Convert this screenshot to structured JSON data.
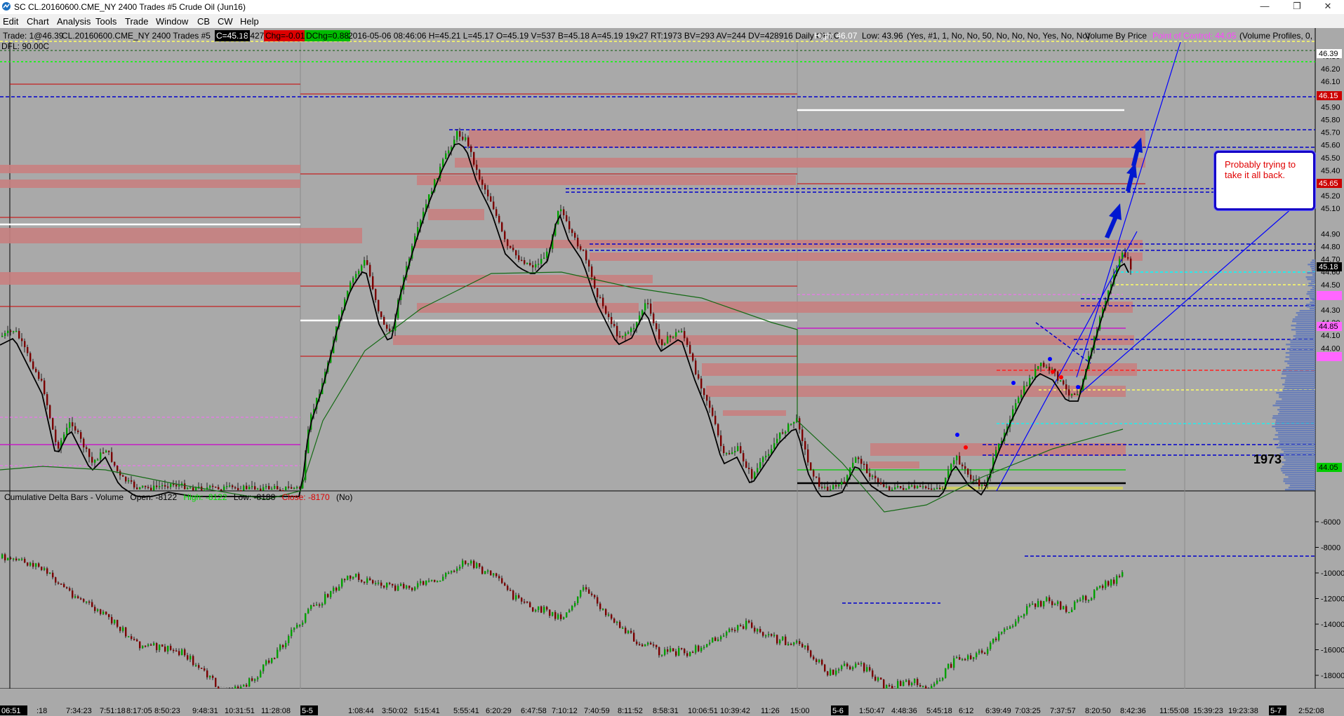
{
  "window": {
    "title": "SC CL.20160600.CME_NY  2400 Trades  #5  Crude Oil (Jun16)",
    "controls": {
      "minimize": "—",
      "restore": "❐",
      "close": "✕"
    }
  },
  "menu": [
    "Edit",
    "Chart",
    "Analysis",
    "Tools",
    "Trade",
    "Window",
    "CB",
    "CW",
    "Help"
  ],
  "header": {
    "trade": "Trade: 1@46.39",
    "symbol": "CL.20160600.CME_NY  2400 Trades  #5",
    "last": "C=45.18",
    "trades": "T=427",
    "chg": "Chg=-0.01",
    "dchg": "DChg=0.88",
    "stats": "2016-05-06 08:46:06 H=45.21 L=45.17 O=45.19 V=537 B=45.18 A=45.19 19x27 RT:1973 BV=293 AV=244 DV=428916 Daily OHLC",
    "high": "High: 46.07",
    "low": "Low: 43.96",
    "params": "(Yes, #1, 1, No, No, 50, No, No, No, Yes, No, No)",
    "study": "Volume By Price",
    "poc": "Point of Control: 44.05",
    "vp": "(Volume Profiles, 0,",
    "dfl": "DFL: 90.00C"
  },
  "annotation": {
    "text": "Probably trying to take it all back."
  },
  "counter": "1973",
  "lower_study": {
    "name": "Cumulative Delta Bars - Volume",
    "open": "Open: -8122",
    "high": "High: -8122",
    "low": "Low: -8188",
    "close": "Close: -8170",
    "flag": "(No)"
  },
  "price_tags": {
    "last_trade": "46.39",
    "upper_blue": "46.15",
    "red": "45.65",
    "current": "45.18",
    "magenta": "44.85",
    "green": "44.05",
    "lower_right": "5"
  },
  "price_axis": [
    "46.30",
    "46.20",
    "46.10",
    "46.00",
    "45.90",
    "45.80",
    "45.70",
    "45.60",
    "45.50",
    "45.40",
    "45.30",
    "45.20",
    "45.10",
    "44.90",
    "44.80",
    "44.70",
    "44.60",
    "44.50",
    "44.40",
    "44.30",
    "44.20",
    "44.10",
    "44.00"
  ],
  "delta_axis": [
    "-6000",
    "-8000",
    "-10000",
    "-12000",
    "-14000",
    "-16000",
    "-18000"
  ],
  "time_axis": [
    {
      "label": "06:51",
      "boxed": true
    },
    {
      "label": ":18"
    },
    {
      "label": "7:34:23"
    },
    {
      "label": "7:51:18"
    },
    {
      "label": "8:17:05"
    },
    {
      "label": "8:50:23"
    },
    {
      "label": "9:48:31"
    },
    {
      "label": "10:31:51"
    },
    {
      "label": "11:28:08"
    },
    {
      "label": "5-5",
      "boxed": true
    },
    {
      "label": "1:08:44"
    },
    {
      "label": "3:50:02"
    },
    {
      "label": "5:15:41"
    },
    {
      "label": "5:55:41"
    },
    {
      "label": "6:20:29"
    },
    {
      "label": "6:47:58"
    },
    {
      "label": "7:10:12"
    },
    {
      "label": "7:40:59"
    },
    {
      "label": "8:11:52"
    },
    {
      "label": "8:58:31"
    },
    {
      "label": "10:06:51"
    },
    {
      "label": "10:39:42"
    },
    {
      "label": "11:26"
    },
    {
      "label": "15:00"
    },
    {
      "label": "5-6",
      "boxed": true
    },
    {
      "label": "1:50:47"
    },
    {
      "label": "4:48:36"
    },
    {
      "label": "5:45:18"
    },
    {
      "label": "6:12"
    },
    {
      "label": "6:39:49"
    },
    {
      "label": "7:03:25"
    },
    {
      "label": "7:37:57"
    },
    {
      "label": "8:20:50"
    },
    {
      "label": "8:42:36"
    },
    {
      "label": "11:55:08"
    },
    {
      "label": "15:39:23"
    },
    {
      "label": "19:23:38"
    },
    {
      "label": "5-7",
      "boxed": true
    },
    {
      "label": "2:52:08"
    }
  ],
  "chart_data": {
    "type": "candlestick",
    "title": "Crude Oil (Jun16)",
    "price_range": [
      43.96,
      46.39
    ],
    "delta_range": [
      -18000,
      -6000
    ],
    "session_markers": [
      "5-5",
      "5-6",
      "5-7"
    ],
    "price_levels": [
      {
        "value": 46.39,
        "label": "Last trade"
      },
      {
        "value": 46.15,
        "label": "Blue dashed level"
      },
      {
        "value": 45.65,
        "label": "Red level"
      },
      {
        "value": 45.18,
        "label": "Last price"
      },
      {
        "value": 44.85,
        "label": "Magenta level"
      },
      {
        "value": 44.05,
        "label": "Point of Control"
      }
    ],
    "colors": {
      "background": "#a9a9a9",
      "up": "#00a000",
      "down": "#8b0000",
      "zones": "#c88080",
      "levels": "#0000cc"
    }
  }
}
